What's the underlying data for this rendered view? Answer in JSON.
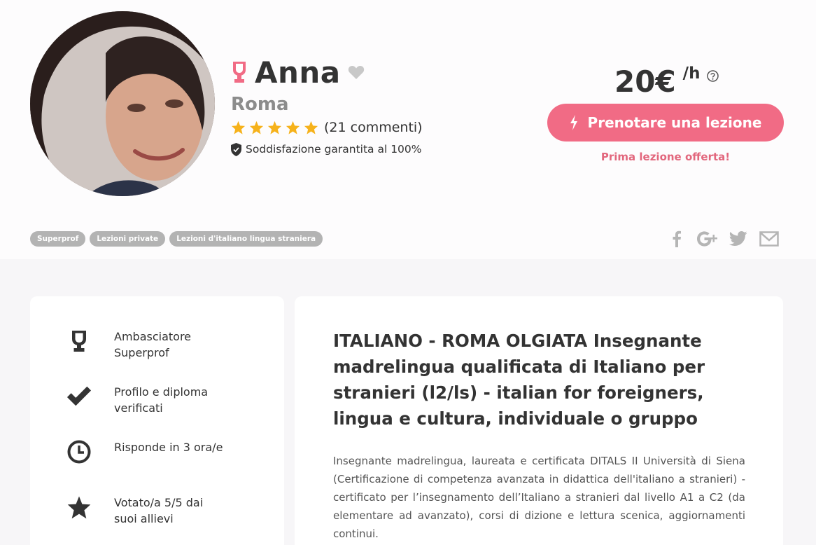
{
  "profile": {
    "name": "Anna",
    "city": "Roma",
    "reviews": "(21 commenti)",
    "rating_stars": 5,
    "guarantee": "Soddisfazione garantita al 100%"
  },
  "pricing": {
    "amount": "20€",
    "unit": "/h",
    "book_button": "Prenotare una lezione",
    "offer": "Prima lezione offerta!"
  },
  "breadcrumbs": [
    "Superprof",
    "Lezioni private",
    "Lezioni d'italiano lingua straniera"
  ],
  "social": [
    "facebook-icon",
    "google-plus-icon",
    "twitter-icon",
    "mail-icon"
  ],
  "features": [
    {
      "icon": "trophy-icon",
      "text": "Ambasciatore Superprof"
    },
    {
      "icon": "checkmark-icon",
      "text": "Profilo e diploma verificati"
    },
    {
      "icon": "clock-icon",
      "text": "Risponde in 3 ora/e"
    },
    {
      "icon": "star-icon",
      "text": "Votato/a 5/5 dai suoi allievi"
    }
  ],
  "description": {
    "title": "ITALIANO - ROMA OLGIATA Insegnante madrelingua qualificata di Italiano per stranieri (l2/ls) - italian for foreigners, lingua e cultura, individuale o gruppo",
    "body": "Insegnante madrelingua, laureata e certificata DITALS II Università di Siena (Certificazione di competenza avanzata in didattica dell'italiano a stranieri) - certificato per l’insegnamento dell’Italiano a stranieri dal livello A1 a C2 (da elementare ad avanzato), corsi di dizione e lettura scenica, aggiornamenti continui."
  },
  "colors": {
    "accent": "#f16b85",
    "offer_text": "#e2677d",
    "star": "#f6b21b",
    "tag_bg": "#b3b3b3",
    "icon_grey": "#b5b5b5"
  }
}
